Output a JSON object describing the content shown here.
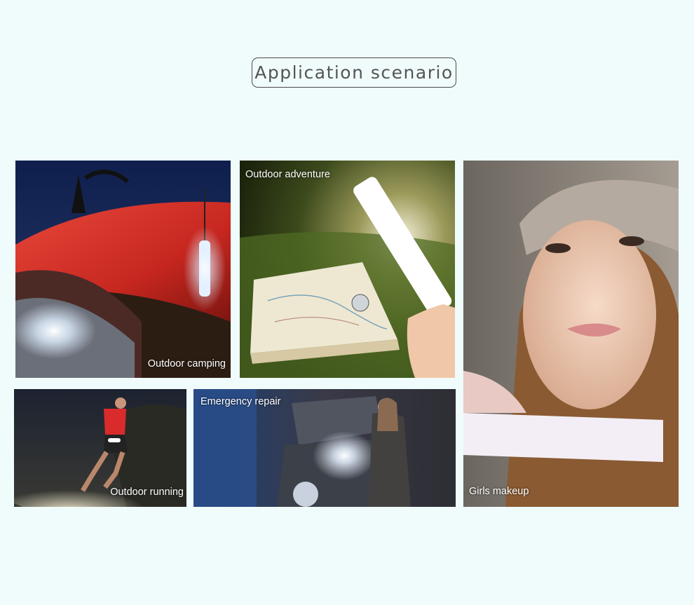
{
  "page": {
    "title": "Application scenario",
    "background_color": "#f0fbfb"
  },
  "scenarios": [
    {
      "label": "Outdoor camping",
      "scene": "tent-with-lamp"
    },
    {
      "label": "Outdoor adventure",
      "scene": "map-on-grass-with-light-tube"
    },
    {
      "label": "Girls makeup",
      "scene": "girl-holding-light-bar"
    },
    {
      "label": "Outdoor running",
      "scene": "runner-at-night"
    },
    {
      "label": "Emergency repair",
      "scene": "car-engine-repair"
    }
  ]
}
